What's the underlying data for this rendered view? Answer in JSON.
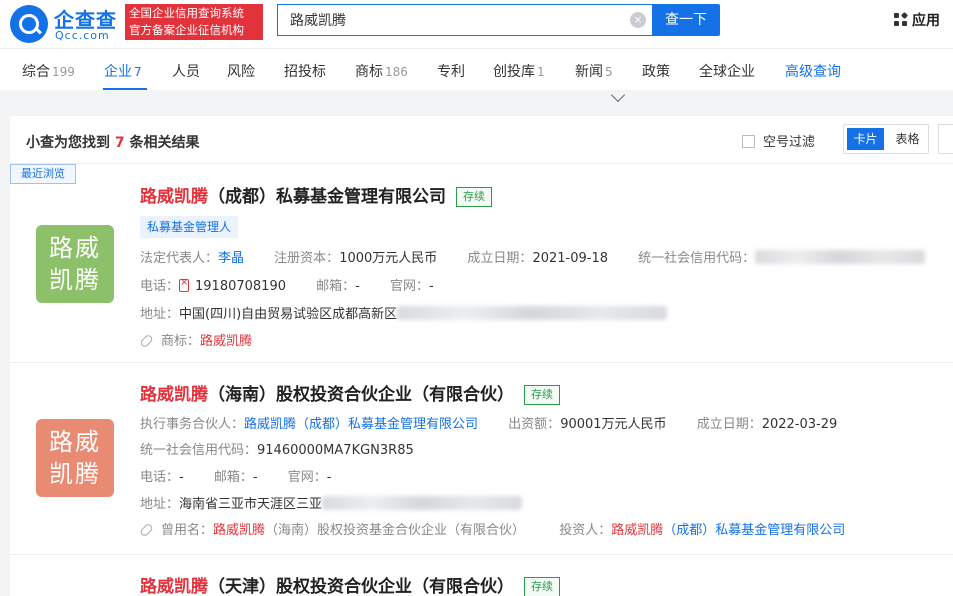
{
  "header": {
    "logo_name": "企查查",
    "logo_domain": "Qcc.com",
    "badge_line1": "全国企业信用查询系统",
    "badge_line2": "官方备案企业征信机构",
    "search_value": "路威凯腾",
    "search_button": "查一下",
    "apps_label": "应用"
  },
  "tabs": [
    {
      "label": "综合",
      "count": "199"
    },
    {
      "label": "企业",
      "count": "7"
    },
    {
      "label": "人员",
      "count": ""
    },
    {
      "label": "风险",
      "count": ""
    },
    {
      "label": "招投标",
      "count": ""
    },
    {
      "label": "商标",
      "count": "186"
    },
    {
      "label": "专利",
      "count": ""
    },
    {
      "label": "创投库",
      "count": "1"
    },
    {
      "label": "新闻",
      "count": "5"
    },
    {
      "label": "政策",
      "count": ""
    },
    {
      "label": "全球企业",
      "count": ""
    },
    {
      "label": "高级查询",
      "count": ""
    }
  ],
  "results": {
    "prefix": "小查为您找到",
    "count": "7",
    "suffix": "条相关结果",
    "filter_label": "空号过滤",
    "view_card": "卡片",
    "view_table": "表格",
    "recent_tag": "最近浏览"
  },
  "companies": [
    {
      "logo_line1": "路威",
      "logo_line2": "凯腾",
      "name_highlight": "路威凯腾",
      "name_rest": "（成都）私募基金管理有限公司",
      "status": "存续",
      "tag": "私募基金管理人",
      "rep_label": "法定代表人：",
      "rep_value": "李晶",
      "capital_label": "注册资本：",
      "capital_value": "1000万元人民币",
      "founded_label": "成立日期：",
      "founded_value": "2021-09-18",
      "credit_label": "统一社会信用代码：",
      "phone_label": "电话：",
      "phone_value": "19180708190",
      "email_label": "邮箱：",
      "email_value": "-",
      "site_label": "官网：",
      "site_value": "-",
      "addr_label": "地址：",
      "addr_value": "中国(四川)自由贸易试验区成都高新区",
      "extra_label": "商标：",
      "extra_value": "路威凯腾"
    },
    {
      "logo_line1": "路威",
      "logo_line2": "凯腾",
      "name_highlight": "路威凯腾",
      "name_rest": "（海南）股权投资合伙企业（有限合伙）",
      "status": "存续",
      "rep_label": "执行事务合伙人：",
      "rep_value": "路威凯腾（成都）私募基金管理有限公司",
      "capital_label": "出资额：",
      "capital_value": "90001万元人民币",
      "founded_label": "成立日期：",
      "founded_value": "2022-03-29",
      "credit_label": "统一社会信用代码：",
      "credit_value": "91460000MA7KGN3R85",
      "phone_label": "电话：",
      "phone_value": "-",
      "email_label": "邮箱：",
      "email_value": "-",
      "site_label": "官网：",
      "site_value": "-",
      "addr_label": "地址：",
      "addr_value": "海南省三亚市天涯区三亚",
      "former_label": "曾用名：",
      "former_highlight": "路威凯腾",
      "former_rest": "（海南）股权投资基金合伙企业（有限合伙）",
      "investor_label": "投资人：",
      "investor_value": "路威凯腾（成都）私募基金管理有限公司"
    },
    {
      "name_highlight": "路威凯腾",
      "name_rest": "（天津）股权投资合伙企业（有限合伙）",
      "status": "存续"
    }
  ]
}
